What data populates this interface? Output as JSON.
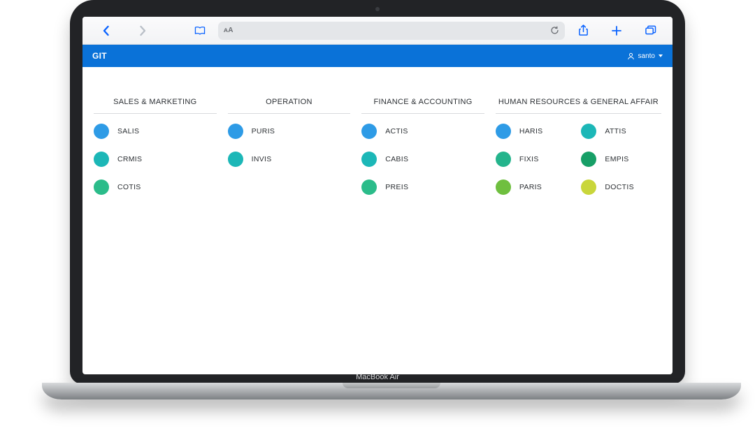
{
  "device": {
    "label": "MacBook Air"
  },
  "browser": {
    "address_text": "ᴀA",
    "icons": {
      "back": "chevron-left-icon",
      "forward": "chevron-right-icon",
      "book": "book-icon",
      "reload": "reload-icon",
      "share": "share-icon",
      "new_tab": "plus-icon",
      "tabs": "tabs-icon"
    }
  },
  "app": {
    "title": "GIT",
    "user": {
      "name": "santo"
    },
    "columns": [
      {
        "title": "SALES & MARKETING",
        "two_cols": false,
        "items": [
          {
            "label": "SALIS",
            "color": "#2E9BE6"
          },
          {
            "label": "CRMIS",
            "color": "#1CB7B7"
          },
          {
            "label": "COTIS",
            "color": "#2BBC8A"
          }
        ]
      },
      {
        "title": "OPERATION",
        "two_cols": false,
        "items": [
          {
            "label": "PURIS",
            "color": "#2E9BE6"
          },
          {
            "label": "INVIS",
            "color": "#1CB7B7"
          }
        ]
      },
      {
        "title": "FINANCE & ACCOUNTING",
        "two_cols": false,
        "items": [
          {
            "label": "ACTIS",
            "color": "#2E9BE6"
          },
          {
            "label": "CABIS",
            "color": "#1CB7B7"
          },
          {
            "label": "PREIS",
            "color": "#2BBC8A"
          }
        ]
      },
      {
        "title": "HUMAN RESOURCES & GENERAL AFFAIR",
        "two_cols": true,
        "items": [
          {
            "label": "HARIS",
            "color": "#2E9BE6"
          },
          {
            "label": "ATTIS",
            "color": "#1CB7B7"
          },
          {
            "label": "FIXIS",
            "color": "#24B48C"
          },
          {
            "label": "EMPIS",
            "color": "#179F67"
          },
          {
            "label": "PARIS",
            "color": "#6FBF3F"
          },
          {
            "label": "DOCTIS",
            "color": "#C9D63B"
          }
        ]
      }
    ]
  }
}
